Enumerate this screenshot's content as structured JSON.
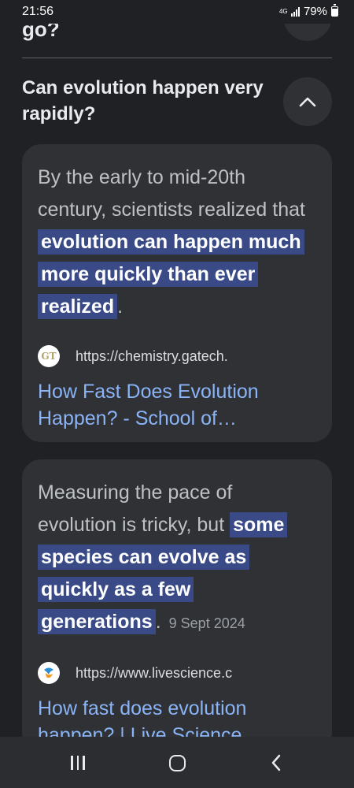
{
  "status_bar": {
    "time": "21:56",
    "network": "4G",
    "battery": "79%",
    "icons": [
      "signal-icon",
      "battery-icon"
    ]
  },
  "previous_question": {
    "text": "go?",
    "toggle_icon": "chevron-down-icon"
  },
  "question": {
    "text": "Can evolution happen very rapidly?",
    "toggle_icon": "chevron-up-icon",
    "expanded": true
  },
  "results": [
    {
      "snippet_before": "By the early to mid-20th century, scientists realized that ",
      "snippet_highlight": "evolution can happen much more quickly than ever realized",
      "snippet_after": ".",
      "date": "",
      "url": "https://chemistry.gatech.",
      "favicon_text": "GT",
      "title": "How Fast Does Evolution Happen? - School of…"
    },
    {
      "snippet_before": "Measuring the pace of evolution is tricky, but ",
      "snippet_highlight": "some species can evolve as quickly as a few generations",
      "snippet_after": ".",
      "date": "9 Sept 2024",
      "url": "https://www.livescience.c",
      "favicon_text": "",
      "title": "How fast does evolution happen? | Live Science"
    }
  ],
  "nav_bar": {
    "buttons": [
      "recents-icon",
      "home-icon",
      "back-icon"
    ]
  },
  "colors": {
    "background": "#202124",
    "card": "#303134",
    "highlight": "#394a87",
    "link": "#8ab4f8"
  }
}
